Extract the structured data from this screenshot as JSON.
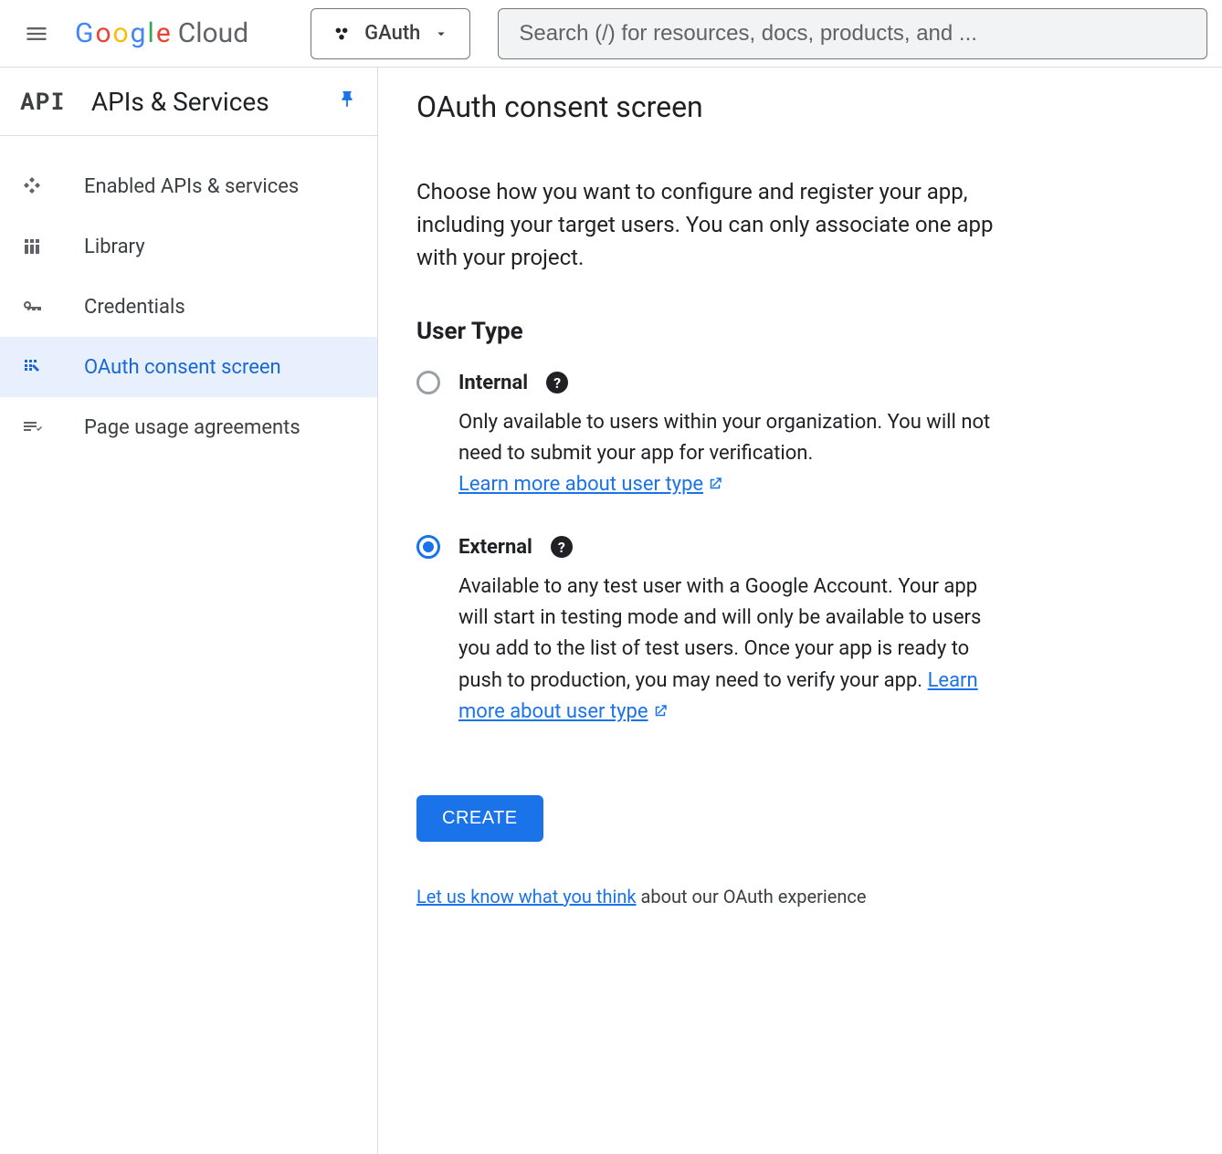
{
  "header": {
    "logo_google": "Google",
    "logo_cloud": "Cloud",
    "project_name": "GAuth",
    "search_placeholder": "Search (/) for resources, docs, products, and ..."
  },
  "sidebar": {
    "badge": "API",
    "title": "APIs & Services",
    "items": [
      {
        "label": "Enabled APIs & services"
      },
      {
        "label": "Library"
      },
      {
        "label": "Credentials"
      },
      {
        "label": "OAuth consent screen"
      },
      {
        "label": "Page usage agreements"
      }
    ]
  },
  "main": {
    "title": "OAuth consent screen",
    "intro": "Choose how you want to configure and register your app, including your target users. You can only associate one app with your project.",
    "user_type_heading": "User Type",
    "internal": {
      "label": "Internal",
      "desc": "Only available to users within your organization. You will not need to submit your app for verification.",
      "link": "Learn more about user type"
    },
    "external": {
      "label": "External",
      "desc": "Available to any test user with a Google Account. Your app will start in testing mode and will only be available to users you add to the list of test users. Once your app is ready to push to production, you may need to verify your app.",
      "link": "Learn more about user type"
    },
    "create_button": "CREATE",
    "feedback_link": "Let us know what you think",
    "feedback_rest": " about our OAuth experience"
  }
}
